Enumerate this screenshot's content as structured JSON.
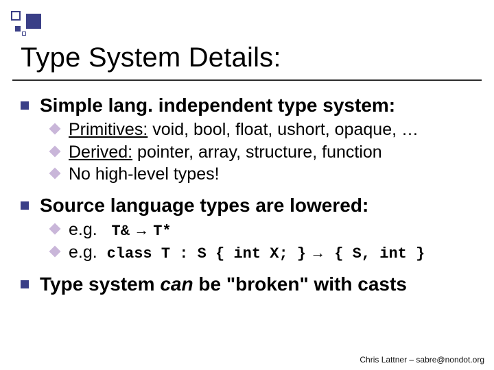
{
  "title": "Type System Details:",
  "points": {
    "p1": {
      "heading": "Simple lang. independent type system:",
      "sub1_label": "Primitives:",
      "sub1_rest": " void, bool, float, ushort, opaque, …",
      "sub2_label": "Derived:",
      "sub2_rest": " pointer, array, structure, function",
      "sub3": "No high-level types!"
    },
    "p2": {
      "heading": "Source language types are lowered:",
      "sub1_label": "e.g.",
      "sub1_code_a": "T&",
      "sub1_arrow": " → ",
      "sub1_code_b": "T*",
      "sub2_label": "e.g.",
      "sub2_code_a": "class T : S { int X; }",
      "sub2_arrow": " → ",
      "sub2_code_b": "{ S, int }"
    },
    "p3": {
      "heading_a": "Type system ",
      "heading_em": "can",
      "heading_b": " be \"broken\" with casts"
    }
  },
  "footer": "Chris Lattner – sabre@nondot.org"
}
